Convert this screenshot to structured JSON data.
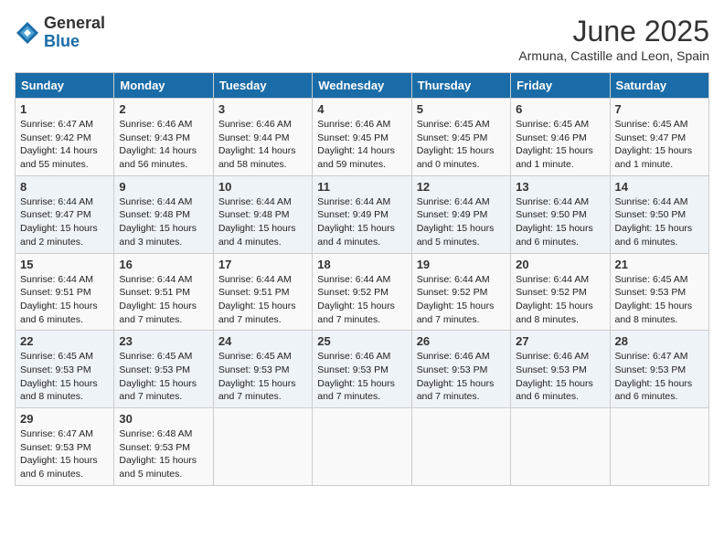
{
  "header": {
    "logo_general": "General",
    "logo_blue": "Blue",
    "month_title": "June 2025",
    "subtitle": "Armuna, Castille and Leon, Spain"
  },
  "calendar": {
    "days_of_week": [
      "Sunday",
      "Monday",
      "Tuesday",
      "Wednesday",
      "Thursday",
      "Friday",
      "Saturday"
    ],
    "weeks": [
      [
        {
          "day": "",
          "info": ""
        },
        {
          "day": "2",
          "info": "Sunrise: 6:46 AM\nSunset: 9:43 PM\nDaylight: 14 hours\nand 56 minutes."
        },
        {
          "day": "3",
          "info": "Sunrise: 6:46 AM\nSunset: 9:44 PM\nDaylight: 14 hours\nand 58 minutes."
        },
        {
          "day": "4",
          "info": "Sunrise: 6:46 AM\nSunset: 9:45 PM\nDaylight: 14 hours\nand 59 minutes."
        },
        {
          "day": "5",
          "info": "Sunrise: 6:45 AM\nSunset: 9:45 PM\nDaylight: 15 hours\nand 0 minutes."
        },
        {
          "day": "6",
          "info": "Sunrise: 6:45 AM\nSunset: 9:46 PM\nDaylight: 15 hours\nand 1 minute."
        },
        {
          "day": "7",
          "info": "Sunrise: 6:45 AM\nSunset: 9:47 PM\nDaylight: 15 hours\nand 1 minute."
        }
      ],
      [
        {
          "day": "1",
          "info": "Sunrise: 6:47 AM\nSunset: 9:42 PM\nDaylight: 14 hours\nand 55 minutes."
        },
        {
          "day": "8",
          "info": "Sunrise: 6:44 AM\nSunset: 9:47 PM\nDaylight: 15 hours\nand 2 minutes."
        },
        {
          "day": "9",
          "info": "Sunrise: 6:44 AM\nSunset: 9:48 PM\nDaylight: 15 hours\nand 3 minutes."
        },
        {
          "day": "10",
          "info": "Sunrise: 6:44 AM\nSunset: 9:48 PM\nDaylight: 15 hours\nand 4 minutes."
        },
        {
          "day": "11",
          "info": "Sunrise: 6:44 AM\nSunset: 9:49 PM\nDaylight: 15 hours\nand 4 minutes."
        },
        {
          "day": "12",
          "info": "Sunrise: 6:44 AM\nSunset: 9:49 PM\nDaylight: 15 hours\nand 5 minutes."
        },
        {
          "day": "13",
          "info": "Sunrise: 6:44 AM\nSunset: 9:50 PM\nDaylight: 15 hours\nand 6 minutes."
        },
        {
          "day": "14",
          "info": "Sunrise: 6:44 AM\nSunset: 9:50 PM\nDaylight: 15 hours\nand 6 minutes."
        }
      ],
      [
        {
          "day": "15",
          "info": "Sunrise: 6:44 AM\nSunset: 9:51 PM\nDaylight: 15 hours\nand 6 minutes."
        },
        {
          "day": "16",
          "info": "Sunrise: 6:44 AM\nSunset: 9:51 PM\nDaylight: 15 hours\nand 7 minutes."
        },
        {
          "day": "17",
          "info": "Sunrise: 6:44 AM\nSunset: 9:51 PM\nDaylight: 15 hours\nand 7 minutes."
        },
        {
          "day": "18",
          "info": "Sunrise: 6:44 AM\nSunset: 9:52 PM\nDaylight: 15 hours\nand 7 minutes."
        },
        {
          "day": "19",
          "info": "Sunrise: 6:44 AM\nSunset: 9:52 PM\nDaylight: 15 hours\nand 7 minutes."
        },
        {
          "day": "20",
          "info": "Sunrise: 6:44 AM\nSunset: 9:52 PM\nDaylight: 15 hours\nand 8 minutes."
        },
        {
          "day": "21",
          "info": "Sunrise: 6:45 AM\nSunset: 9:53 PM\nDaylight: 15 hours\nand 8 minutes."
        }
      ],
      [
        {
          "day": "22",
          "info": "Sunrise: 6:45 AM\nSunset: 9:53 PM\nDaylight: 15 hours\nand 8 minutes."
        },
        {
          "day": "23",
          "info": "Sunrise: 6:45 AM\nSunset: 9:53 PM\nDaylight: 15 hours\nand 7 minutes."
        },
        {
          "day": "24",
          "info": "Sunrise: 6:45 AM\nSunset: 9:53 PM\nDaylight: 15 hours\nand 7 minutes."
        },
        {
          "day": "25",
          "info": "Sunrise: 6:46 AM\nSunset: 9:53 PM\nDaylight: 15 hours\nand 7 minutes."
        },
        {
          "day": "26",
          "info": "Sunrise: 6:46 AM\nSunset: 9:53 PM\nDaylight: 15 hours\nand 7 minutes."
        },
        {
          "day": "27",
          "info": "Sunrise: 6:46 AM\nSunset: 9:53 PM\nDaylight: 15 hours\nand 6 minutes."
        },
        {
          "day": "28",
          "info": "Sunrise: 6:47 AM\nSunset: 9:53 PM\nDaylight: 15 hours\nand 6 minutes."
        }
      ],
      [
        {
          "day": "29",
          "info": "Sunrise: 6:47 AM\nSunset: 9:53 PM\nDaylight: 15 hours\nand 6 minutes."
        },
        {
          "day": "30",
          "info": "Sunrise: 6:48 AM\nSunset: 9:53 PM\nDaylight: 15 hours\nand 5 minutes."
        },
        {
          "day": "",
          "info": ""
        },
        {
          "day": "",
          "info": ""
        },
        {
          "day": "",
          "info": ""
        },
        {
          "day": "",
          "info": ""
        },
        {
          "day": "",
          "info": ""
        }
      ]
    ]
  }
}
